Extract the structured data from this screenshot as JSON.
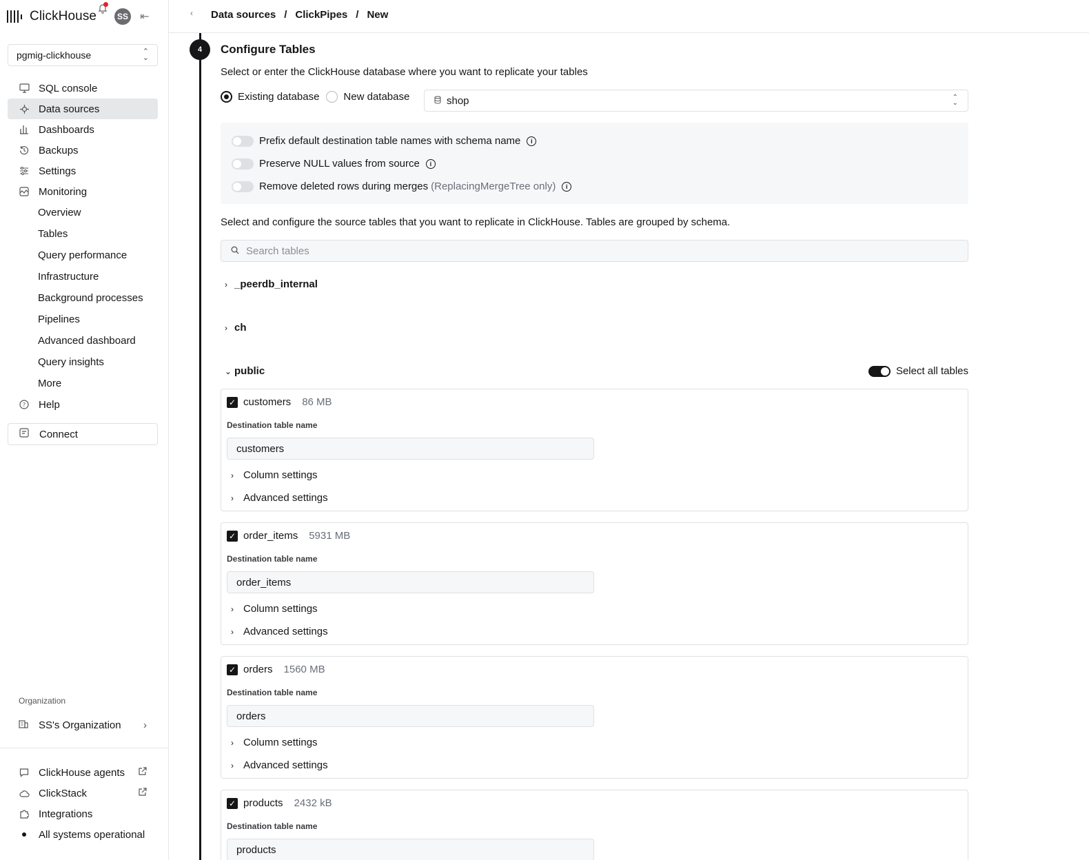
{
  "app": {
    "brand": "ClickHouse",
    "avatar_initials": "SS",
    "service": "pgmig-clickhouse"
  },
  "sidebar": {
    "items": [
      {
        "label": "SQL console",
        "icon": "monitor-icon"
      },
      {
        "label": "Data sources",
        "icon": "plug-icon",
        "active": true
      },
      {
        "label": "Dashboards",
        "icon": "bar-chart-icon"
      },
      {
        "label": "Backups",
        "icon": "history-icon"
      },
      {
        "label": "Settings",
        "icon": "sliders-icon"
      },
      {
        "label": "Monitoring",
        "icon": "activity-icon"
      }
    ],
    "monitoring_sub": [
      "Overview",
      "Tables",
      "Query performance",
      "Infrastructure",
      "Background processes",
      "Pipelines",
      "Advanced dashboard",
      "Query insights",
      "More"
    ],
    "help": "Help",
    "connect": "Connect",
    "org_label": "Organization",
    "org_name": "SS's Organization",
    "bottom": {
      "agents": "ClickHouse agents",
      "clickstack": "ClickStack",
      "integrations": "Integrations",
      "status": "All systems operational"
    }
  },
  "header": {
    "breadcrumb": [
      "Data sources",
      "ClickPipes",
      "New"
    ]
  },
  "step": {
    "number": "4",
    "title": "Configure Tables",
    "subtitle": "Select or enter the ClickHouse database where you want to replicate your tables",
    "radio_existing": "Existing database",
    "radio_new": "New database",
    "database": "shop",
    "options": {
      "prefix": "Prefix default destination table names with schema name",
      "preserve_null": "Preserve NULL values from source",
      "remove_deleted": "Remove deleted rows during merges",
      "remove_deleted_note": "(ReplacingMergeTree only)"
    },
    "tables_desc": "Select and configure the source tables that you want to replicate in ClickHouse. Tables are grouped by schema.",
    "search_placeholder": "Search tables",
    "schemas": [
      "_peerdb_internal",
      "ch",
      "public"
    ],
    "select_all": "Select all tables",
    "dest_label": "Destination table name",
    "column_settings": "Column settings",
    "advanced_settings": "Advanced settings",
    "tables": [
      {
        "name": "customers",
        "size": "86 MB",
        "dest": "customers"
      },
      {
        "name": "order_items",
        "size": "5931 MB",
        "dest": "order_items"
      },
      {
        "name": "orders",
        "size": "1560 MB",
        "dest": "orders"
      },
      {
        "name": "products",
        "size": "2432 kB",
        "dest": "products"
      }
    ]
  }
}
